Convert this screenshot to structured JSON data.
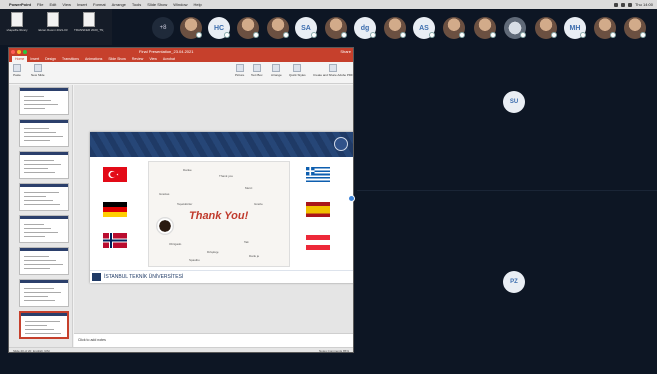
{
  "menubar": {
    "app": "PowerPoint",
    "items": [
      "File",
      "Edit",
      "View",
      "Insert",
      "Format",
      "Arrange",
      "Tools",
      "Slide Show",
      "Window",
      "Help"
    ],
    "time": "Thu 14:00"
  },
  "desktop": {
    "icons": [
      {
        "label": "shapefile library"
      },
      {
        "label": "Ekran Resmi 2021-03"
      },
      {
        "label": "TRANSFER 2020_TN_v7"
      }
    ]
  },
  "participants": [
    {
      "type": "plus",
      "text": "+8"
    },
    {
      "type": "photo"
    },
    {
      "type": "init",
      "text": "HC"
    },
    {
      "type": "photo"
    },
    {
      "type": "photo"
    },
    {
      "type": "init",
      "text": "SA"
    },
    {
      "type": "photo"
    },
    {
      "type": "init",
      "text": "dg"
    },
    {
      "type": "photo"
    },
    {
      "type": "init",
      "text": "AS"
    },
    {
      "type": "photo"
    },
    {
      "type": "photo"
    },
    {
      "type": "tech"
    },
    {
      "type": "photo"
    },
    {
      "type": "init",
      "text": "MH"
    },
    {
      "type": "photo"
    },
    {
      "type": "photo"
    }
  ],
  "ppt": {
    "title": "Final Presentation_23.04.2021",
    "share_label": "Share",
    "tabs": [
      "Home",
      "Insert",
      "Design",
      "Transitions",
      "Animations",
      "Slide Show",
      "Review",
      "View",
      "Acrobat"
    ],
    "active_tab": "Home",
    "ribbon": {
      "paste": "Paste",
      "new_slide": "New Slide",
      "picture": "Picture",
      "text_box": "Text Box",
      "arrange": "Arrange",
      "quick_styles": "Quick Styles",
      "create_pdf": "Create and Share Adobe PDF"
    },
    "slide": {
      "thank_you": "Thank You!",
      "footer_text": "İSTANBUL TEKNİK ÜNİVERSİTESİ",
      "words": [
        "Danke",
        "Thank you",
        "Gracias",
        "Merci",
        "Teşekkürler",
        "Grazie",
        "Obrigado",
        "Dziękuję",
        "Tak",
        "Spasibo",
        "Dank je"
      ]
    },
    "notes_placeholder": "Click to add notes",
    "slide_count": "Slide 20 of 20",
    "language": "English (US)",
    "status_right": "Notes   Comments   85%",
    "selected_thumb": 10,
    "flag_colors": {
      "turkey": "#e30a17",
      "germany_top": "#000000",
      "germany_mid": "#dd0000",
      "germany_bot": "#ffce00",
      "norway_red": "#ba0c2f",
      "norway_blue": "#00205b",
      "greece": "#0d5eaf",
      "spain_red": "#aa151b",
      "spain_yellow": "#f1bf00",
      "austria": "#ed2939"
    }
  },
  "tiles": [
    {
      "text": "SU"
    },
    {
      "text": "PZ"
    }
  ]
}
